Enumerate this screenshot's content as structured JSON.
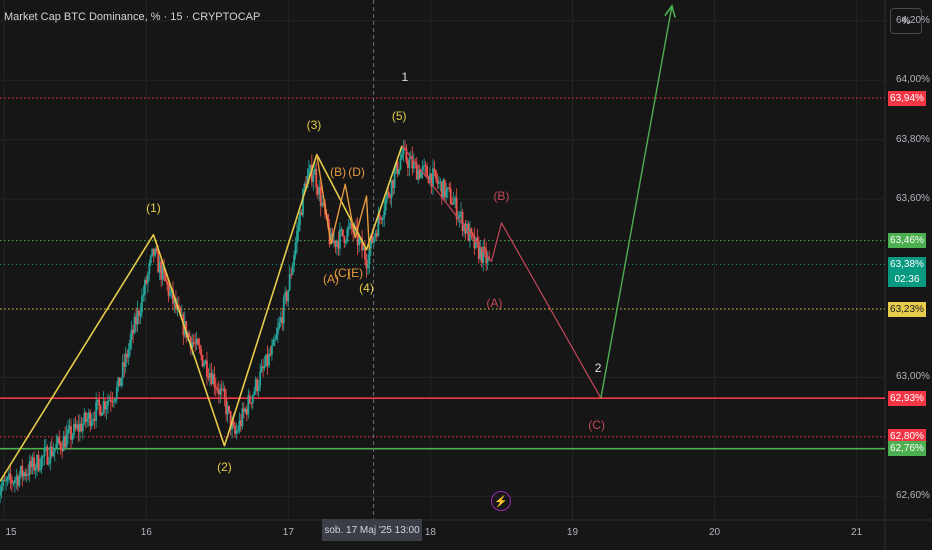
{
  "header": {
    "title": "Market Cap BTC Dominance, % · 15 · CRYPTOCAP"
  },
  "scale_button": "%",
  "colors": {
    "background": "#161616",
    "up": "#26a69a",
    "down": "#ef5350",
    "wave_yellow": "#e6cc4a",
    "wave_orange": "#e69a3c",
    "correction_red": "#c2475a",
    "target_green": "#4caf50"
  },
  "chart_data": {
    "type": "candlestick",
    "title": "Market Cap BTC Dominance, % · 15 · CRYPTOCAP",
    "y_unit": "%",
    "ylim": [
      62.52,
      64.27
    ],
    "xlim": [
      14.97,
      21.2
    ],
    "y_ticks": [
      "64,20%",
      "64,00%",
      "63,80%",
      "63,60%",
      "63,00%",
      "62,60%"
    ],
    "x_ticks": [
      {
        "label": "15",
        "x": 15.0
      },
      {
        "label": "16",
        "x": 16.0
      },
      {
        "label": "17",
        "x": 17.0
      },
      {
        "label": "18",
        "x": 18.0
      },
      {
        "label": "19",
        "x": 19.0
      },
      {
        "label": "20",
        "x": 20.0
      },
      {
        "label": "21",
        "x": 21.0
      }
    ],
    "price_path": [
      [
        14.95,
        62.62
      ],
      [
        15.2,
        62.7
      ],
      [
        15.5,
        62.82
      ],
      [
        15.8,
        62.96
      ],
      [
        16.0,
        63.32
      ],
      [
        16.05,
        63.42
      ],
      [
        16.25,
        63.18
      ],
      [
        16.45,
        63.02
      ],
      [
        16.55,
        62.92
      ],
      [
        16.62,
        62.8
      ],
      [
        16.75,
        62.95
      ],
      [
        16.9,
        63.1
      ],
      [
        17.0,
        63.3
      ],
      [
        17.12,
        63.66
      ],
      [
        17.18,
        63.7
      ],
      [
        17.3,
        63.45
      ],
      [
        17.45,
        63.5
      ],
      [
        17.55,
        63.4
      ],
      [
        17.65,
        63.55
      ],
      [
        17.8,
        63.75
      ],
      [
        17.9,
        63.7
      ],
      [
        18.0,
        63.68
      ],
      [
        18.15,
        63.6
      ],
      [
        18.3,
        63.45
      ],
      [
        18.42,
        63.38
      ]
    ],
    "horizontal_levels": [
      {
        "value": 63.94,
        "label": "63,94%",
        "color": "#f23645",
        "style": "dotted"
      },
      {
        "value": 63.46,
        "label": "63,46%",
        "color": "#4caf50",
        "style": "dotted"
      },
      {
        "value": 63.23,
        "label": "63,23%",
        "color": "#e6cc4a",
        "style": "dotted"
      },
      {
        "value": 62.93,
        "label": "62,93%",
        "color": "#f23645",
        "style": "solid"
      },
      {
        "value": 62.8,
        "label": "62,80%",
        "color": "#f23645",
        "style": "dotted"
      },
      {
        "value": 62.76,
        "label": "62,76%",
        "color": "#4caf50",
        "style": "solid"
      }
    ],
    "last_price": {
      "value": 63.38,
      "label": "63,38%",
      "countdown": "02:36",
      "color": "#089981"
    },
    "cursor": {
      "x": 17.6,
      "label": "sob. 17 Maj '25   13:00"
    },
    "waves": {
      "impulse_yellow": [
        [
          14.97,
          62.65
        ],
        [
          16.05,
          63.48
        ],
        [
          16.55,
          62.77
        ],
        [
          17.2,
          63.75
        ],
        [
          17.55,
          63.43
        ],
        [
          17.8,
          63.78
        ]
      ],
      "impulse_labels": [
        {
          "text": "(1)",
          "x": 16.05,
          "y": 63.57
        },
        {
          "text": "(2)",
          "x": 16.55,
          "y": 62.7
        },
        {
          "text": "(3)",
          "x": 17.18,
          "y": 63.85
        },
        {
          "text": "(4)",
          "x": 17.55,
          "y": 63.3
        },
        {
          "text": "(5)",
          "x": 17.78,
          "y": 63.88
        }
      ],
      "subwave_orange": [
        [
          17.2,
          63.75
        ],
        [
          17.3,
          63.45
        ],
        [
          17.4,
          63.65
        ],
        [
          17.47,
          63.47
        ],
        [
          17.55,
          63.61
        ],
        [
          17.57,
          63.43
        ]
      ],
      "subwave_labels": [
        {
          "text": "(B)",
          "x": 17.35,
          "y": 63.69
        },
        {
          "text": "(D)",
          "x": 17.48,
          "y": 63.69
        },
        {
          "text": "(A)",
          "x": 17.3,
          "y": 63.33
        },
        {
          "text": "(C)",
          "x": 17.38,
          "y": 63.35
        },
        {
          "text": "(E)",
          "x": 17.47,
          "y": 63.35
        }
      ],
      "correction_red": [
        [
          17.8,
          63.78
        ],
        [
          18.43,
          63.39
        ],
        [
          18.5,
          63.52
        ],
        [
          19.2,
          62.93
        ]
      ],
      "correction_labels": [
        {
          "text": "(A)",
          "x": 18.45,
          "y": 63.25
        },
        {
          "text": "(B)",
          "x": 18.5,
          "y": 63.61
        },
        {
          "text": "(C)",
          "x": 19.17,
          "y": 62.84
        }
      ],
      "target_green": [
        [
          19.2,
          62.93
        ],
        [
          19.7,
          64.25
        ]
      ],
      "degree_labels": [
        {
          "text": "1",
          "x": 17.82,
          "y": 64.01
        },
        {
          "text": "2",
          "x": 19.18,
          "y": 63.03
        }
      ]
    }
  }
}
